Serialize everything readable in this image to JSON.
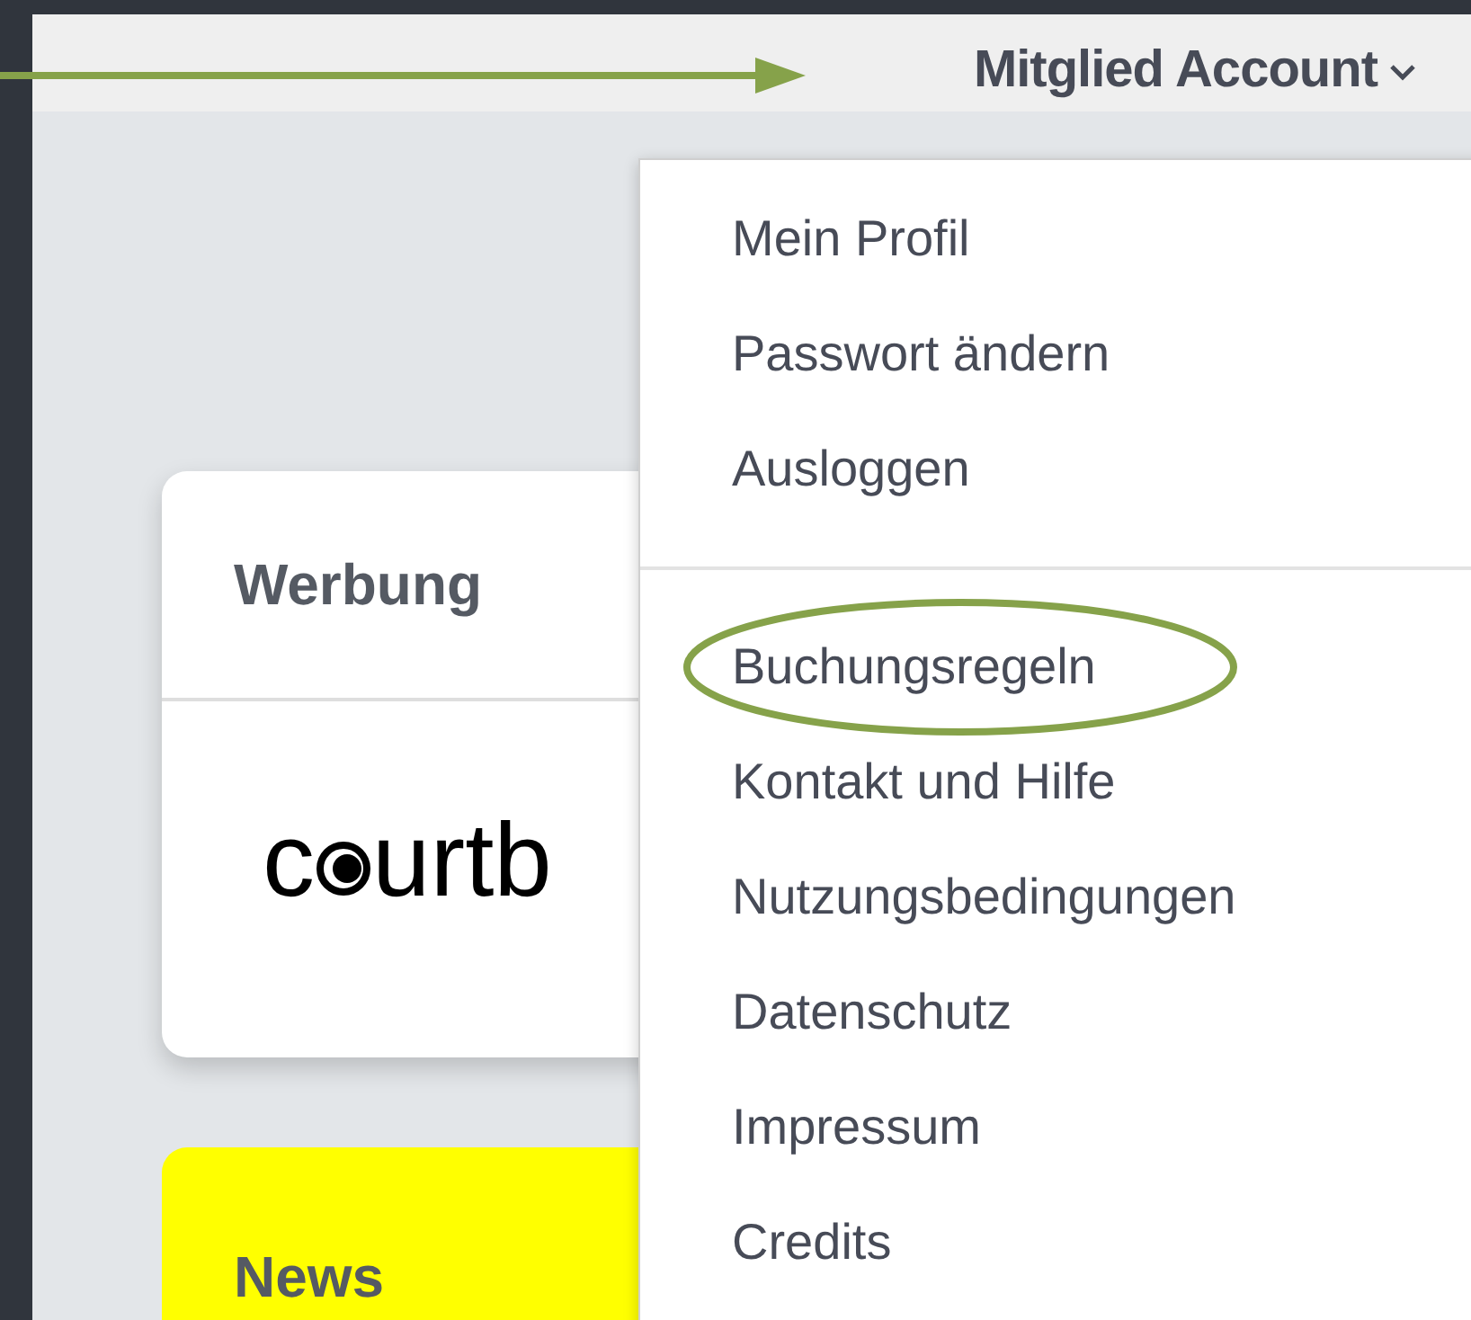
{
  "header": {
    "account_menu": "Mitglied Account",
    "expanded": true
  },
  "ad_card": {
    "title": "Werbung",
    "logo_before": "c",
    "logo_after": "urtb"
  },
  "news_card": {
    "title": "News"
  },
  "menu": {
    "groups": [
      {
        "items": [
          {
            "label": "Mein Profil",
            "circled": false
          },
          {
            "label": "Passwort ändern",
            "circled": false
          },
          {
            "label": "Ausloggen",
            "circled": false
          }
        ]
      },
      {
        "items": [
          {
            "label": "Buchungsregeln",
            "circled": true
          },
          {
            "label": "Kontakt und Hilfe",
            "circled": false
          },
          {
            "label": "Nutzungsbedingungen",
            "circled": false
          },
          {
            "label": "Datenschutz",
            "circled": false
          },
          {
            "label": "Impressum",
            "circled": false
          },
          {
            "label": "Credits",
            "circled": false
          }
        ]
      }
    ]
  }
}
